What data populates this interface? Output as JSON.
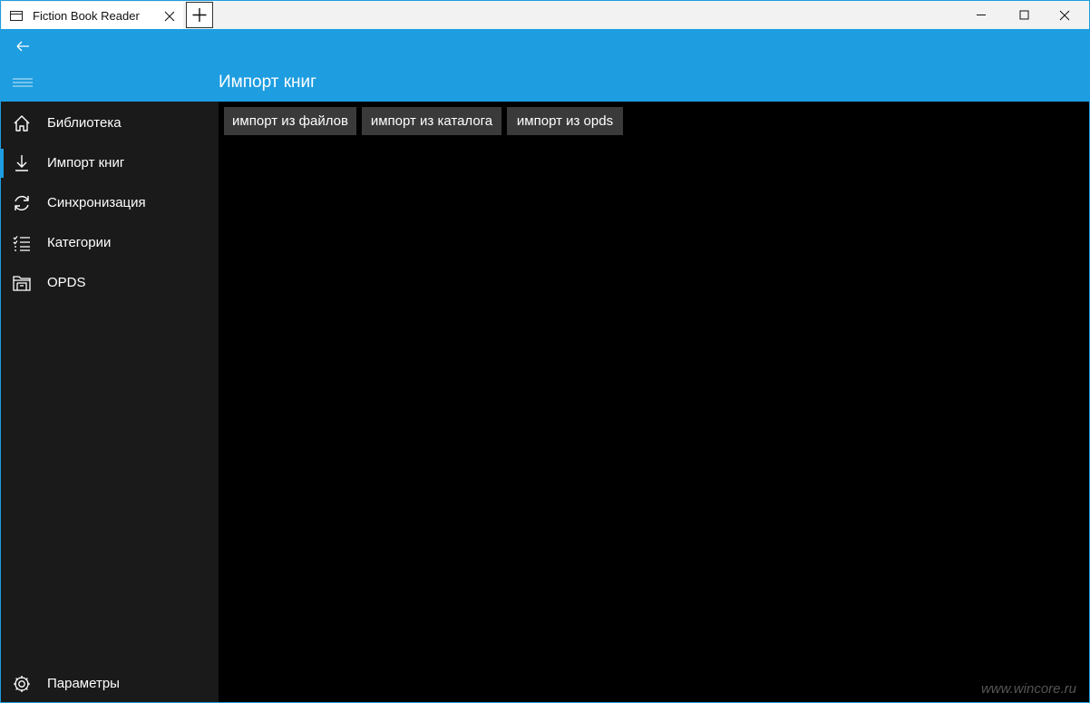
{
  "window": {
    "tab_title": "Fiction Book Reader"
  },
  "header": {
    "page_title": "Импорт книг"
  },
  "sidebar": {
    "items": [
      {
        "label": "Библиотека",
        "icon": "home-icon",
        "selected": false
      },
      {
        "label": "Импорт книг",
        "icon": "download-icon",
        "selected": true
      },
      {
        "label": "Синхронизация",
        "icon": "sync-icon",
        "selected": false
      },
      {
        "label": "Категории",
        "icon": "checklist-icon",
        "selected": false
      },
      {
        "label": "OPDS",
        "icon": "catalog-folder-icon",
        "selected": false
      }
    ],
    "settings": {
      "label": "Параметры",
      "icon": "gear-icon"
    }
  },
  "content": {
    "buttons": [
      {
        "label": "импорт из файлов"
      },
      {
        "label": "импорт из каталога"
      },
      {
        "label": "импорт из opds"
      }
    ]
  },
  "watermark": "www.wincore.ru",
  "colors": {
    "accent": "#1e9de0",
    "sidebar_bg": "#1a1a1a",
    "content_bg": "#000000",
    "button_bg": "#3a3a3a"
  }
}
